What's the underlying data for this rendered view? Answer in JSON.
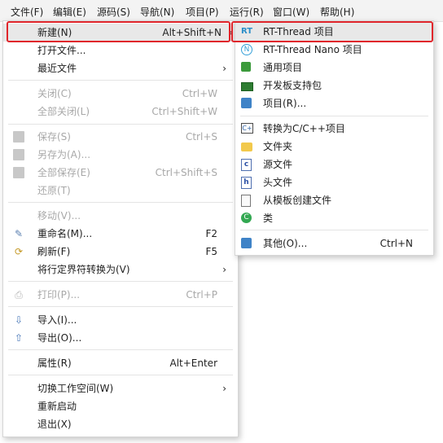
{
  "menubar": {
    "items": [
      {
        "label": "文件(F)"
      },
      {
        "label": "编辑(E)"
      },
      {
        "label": "源码(S)"
      },
      {
        "label": "导航(N)"
      },
      {
        "label": "项目(P)"
      },
      {
        "label": "运行(R)"
      },
      {
        "label": "窗口(W)"
      },
      {
        "label": "帮助(H)"
      }
    ]
  },
  "file_menu": {
    "new": {
      "label": "新建(N)",
      "shortcut": "Alt+Shift+N",
      "arrow": "›"
    },
    "open_file": {
      "label": "打开文件..."
    },
    "recent_files": {
      "label": "最近文件",
      "arrow": "›"
    },
    "close": {
      "label": "关闭(C)",
      "shortcut": "Ctrl+W"
    },
    "close_all": {
      "label": "全部关闭(L)",
      "shortcut": "Ctrl+Shift+W"
    },
    "save": {
      "label": "保存(S)",
      "shortcut": "Ctrl+S"
    },
    "save_as": {
      "label": "另存为(A)..."
    },
    "save_all": {
      "label": "全部保存(E)",
      "shortcut": "Ctrl+Shift+S"
    },
    "revert": {
      "label": "还原(T)"
    },
    "move": {
      "label": "移动(V)..."
    },
    "rename": {
      "label": "重命名(M)...",
      "shortcut": "F2"
    },
    "refresh": {
      "label": "刷新(F)",
      "shortcut": "F5"
    },
    "convert_line_delimiters": {
      "label": "将行定界符转换为(V)",
      "arrow": "›"
    },
    "print": {
      "label": "打印(P)...",
      "shortcut": "Ctrl+P"
    },
    "import": {
      "label": "导入(I)..."
    },
    "export": {
      "label": "导出(O)..."
    },
    "properties": {
      "label": "属性(R)",
      "shortcut": "Alt+Enter"
    },
    "switch_workspace": {
      "label": "切换工作空间(W)",
      "arrow": "›"
    },
    "restart": {
      "label": "重新启动"
    },
    "exit": {
      "label": "退出(X)"
    }
  },
  "new_submenu": {
    "rt_thread_project": {
      "label": "RT-Thread 项目",
      "icon_text": "RT"
    },
    "rt_thread_nano_project": {
      "label": "RT-Thread Nano 项目",
      "icon_text": "N"
    },
    "general_project": {
      "label": "通用项目"
    },
    "bsp_package": {
      "label": "开发板支持包"
    },
    "project": {
      "label": "项目(R)..."
    },
    "convert_to_cpp": {
      "label": "转换为C/C++项目",
      "icon_text": "C+"
    },
    "folder": {
      "label": "文件夹"
    },
    "source_file": {
      "label": "源文件",
      "icon_text": "c"
    },
    "header_file": {
      "label": "头文件",
      "icon_text": "h"
    },
    "from_template": {
      "label": "从模板创建文件"
    },
    "class": {
      "label": "类",
      "icon_text": "C"
    },
    "other": {
      "label": "其他(O)...",
      "shortcut": "Ctrl+N"
    }
  },
  "icons": {
    "save": "save-icon",
    "rename": "rename-icon",
    "refresh": "refresh-icon",
    "print": "print-icon",
    "import": "import-icon",
    "export": "export-icon"
  },
  "colors": {
    "highlight_box": "#e0262c",
    "menubar_bg": "#f3f3f3",
    "disabled_text": "#a8a8a8"
  }
}
